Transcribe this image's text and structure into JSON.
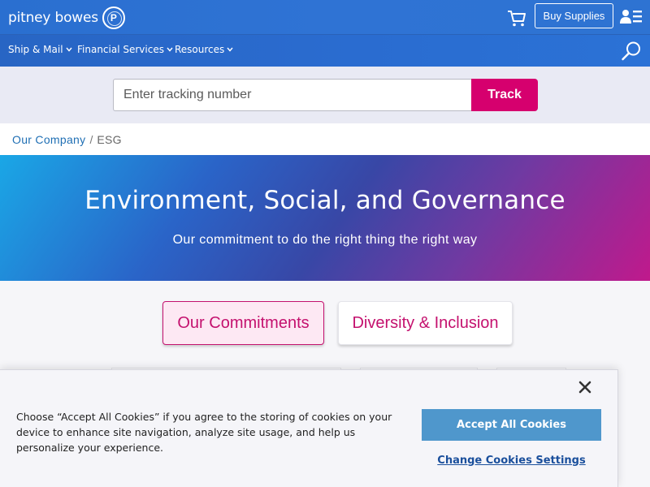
{
  "header": {
    "logo_text": "pitney bowes",
    "buy_supplies_label": "Buy Supplies",
    "icons": [
      "cart-icon",
      "account-menu-icon",
      "logo-mark-icon"
    ]
  },
  "nav": {
    "items": [
      {
        "label": "Ship & Mail"
      },
      {
        "label": "Financial Services"
      },
      {
        "label": "Resources"
      }
    ],
    "search_icon": "search-icon"
  },
  "tracking": {
    "placeholder": "Enter tracking number",
    "button_label": "Track"
  },
  "breadcrumb": {
    "parent": "Our Company",
    "separator": "/",
    "current": "ESG"
  },
  "hero": {
    "title": "Environment, Social, and Governance",
    "subtitle": "Our commitment to do the right thing the right way"
  },
  "tabs": [
    {
      "label": "Our Commitments",
      "active": true
    },
    {
      "label": "Diversity & Inclusion",
      "active": false
    }
  ],
  "cookie_banner": {
    "text": "Choose “Accept All Cookies” if you agree to the storing of cookies on your device to enhance site navigation, analyze site usage, and help us personalize your experience.",
    "accept_label": "Accept All Cookies",
    "settings_label": "Change Cookies Settings"
  },
  "colors": {
    "brand_blue": "#2a6fd0",
    "accent_magenta": "#d6006e",
    "link_blue": "#1f6fb4",
    "cookie_button": "#4f97cc"
  }
}
